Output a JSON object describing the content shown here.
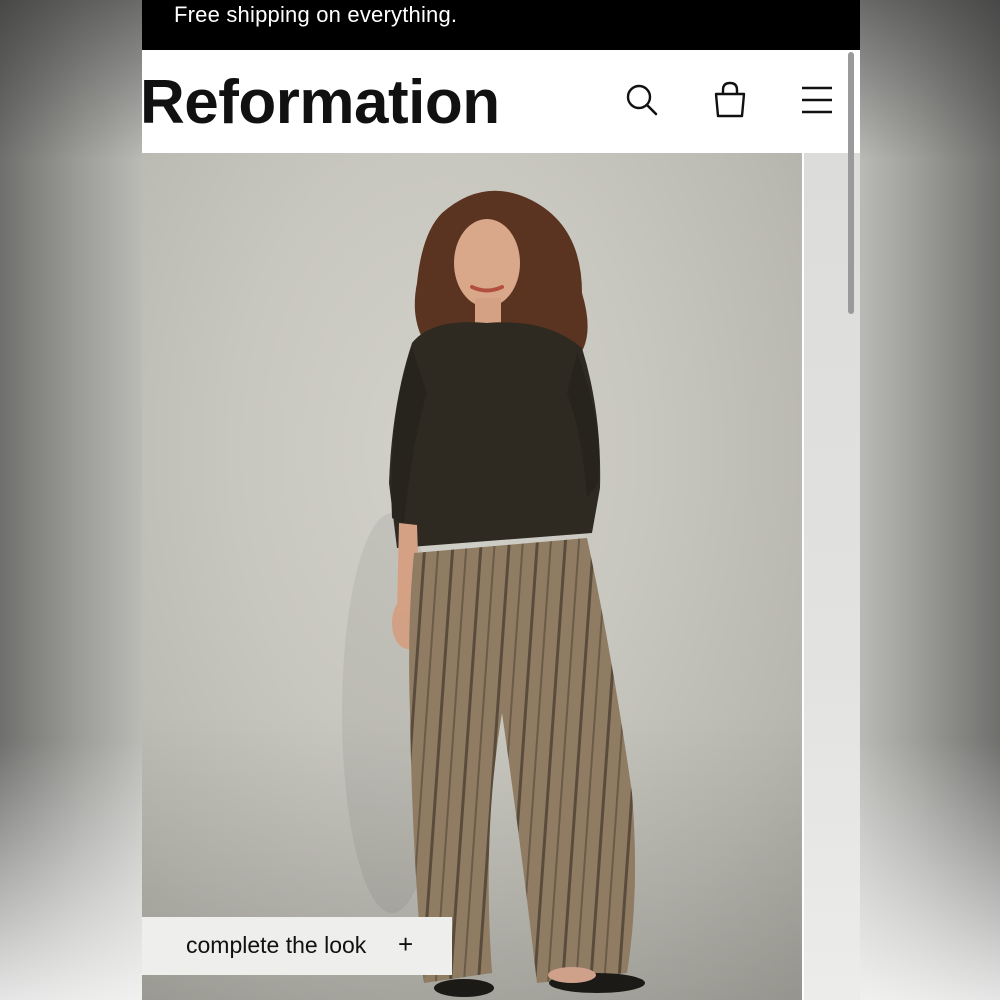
{
  "promo": {
    "text": "Free shipping on everything."
  },
  "header": {
    "logo": "Reformation",
    "icons": [
      "search-icon",
      "shopping-bag-icon",
      "menu-icon"
    ]
  },
  "hero": {
    "cta_label": "complete the look",
    "cta_symbol": "+"
  },
  "colors": {
    "promo_bg": "#000000",
    "promo_text": "#ffffff",
    "header_bg": "#ffffff",
    "logo": "#111111",
    "hero_bg": "#c8c7bf",
    "cta_bg": "#eeeeec"
  }
}
